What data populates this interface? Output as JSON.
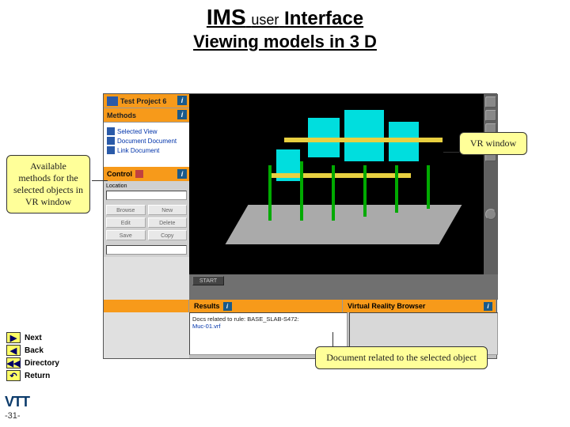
{
  "title": {
    "ims": "IMS",
    "user": "user",
    "interface": "Interface",
    "subtitle": "Viewing models in 3 D"
  },
  "left_panel": {
    "top_bar": "Test Project 6",
    "methods_bar": "Methods",
    "methods": {
      "item1": "Selected View",
      "item2": "Document Document",
      "item3": "Link Document"
    },
    "control_bar": "Control",
    "location_label": "Location",
    "buttons": {
      "b1": "Browse",
      "b2": "New",
      "b3": "Edit",
      "b4": "Delete",
      "b5": "Save",
      "b6": "Copy"
    }
  },
  "viewport": {
    "start": "START"
  },
  "bottom_tabs": {
    "results": "Results",
    "vr": "Virtual Reality Browser"
  },
  "results": {
    "line1": "Docs related to rule: BASE_SLAB-S472:",
    "line2": "Muc-01.vrf"
  },
  "callouts": {
    "methods": "Available methods for the selected objects in VR window",
    "vr": "VR window",
    "doc": "Document related to the selected object"
  },
  "nav": {
    "next": "Next",
    "back": "Back",
    "directory": "Directory",
    "return": "Return"
  },
  "footer": {
    "logo": "VTT",
    "page": "-31-"
  }
}
